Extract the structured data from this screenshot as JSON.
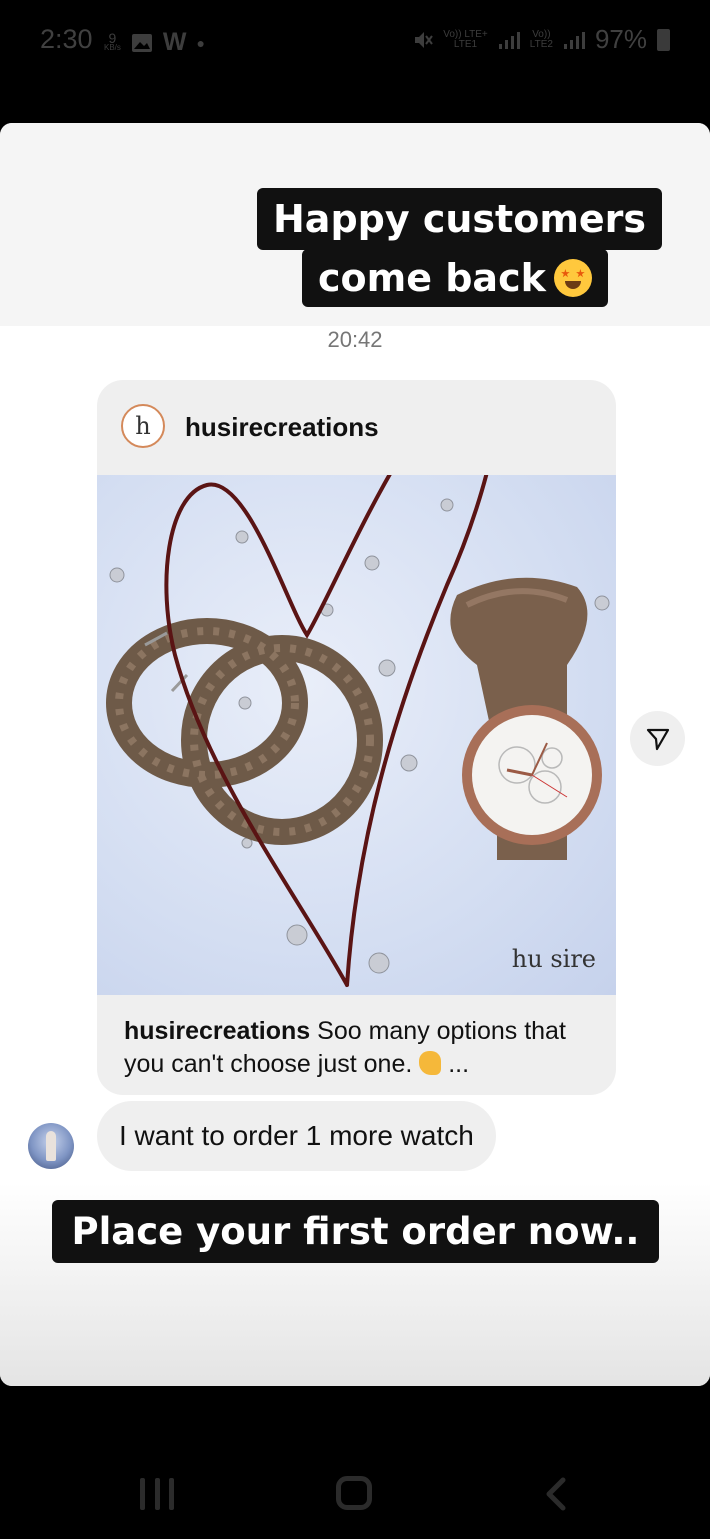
{
  "status_bar": {
    "time": "2:30",
    "left_icons": [
      "notification-count-icon",
      "gallery-icon",
      "w-app-icon",
      "dot-icon"
    ],
    "notification_count": "9",
    "notification_unit": "KB/s",
    "sim1_label": "Vo)) LTE+",
    "sim1_sub": "LTE1",
    "sim2_label": "Vo))",
    "sim2_sub": "LTE2",
    "battery_percent": "97%"
  },
  "story": {
    "headline_line1": "Happy customers",
    "headline_line2": "come back",
    "headline_emoji": "star-struck-emoji-icon",
    "timestamp": "20:42",
    "shared_post": {
      "avatar_letter": "h",
      "username": "husirecreations",
      "caption_username": "husirecreations",
      "caption_text": "Soo many options that you can't choose just one.",
      "caption_emoji": "pinching-hand-emoji-icon",
      "caption_ellipsis": "...",
      "watermark": "hu sire"
    },
    "message": "I want to order 1 more watch",
    "cta": "Place your first order  now.."
  },
  "colors": {
    "headline_bg": "#111111",
    "bubble_bg": "#efefef",
    "drawn_heart": "#5a1414"
  }
}
